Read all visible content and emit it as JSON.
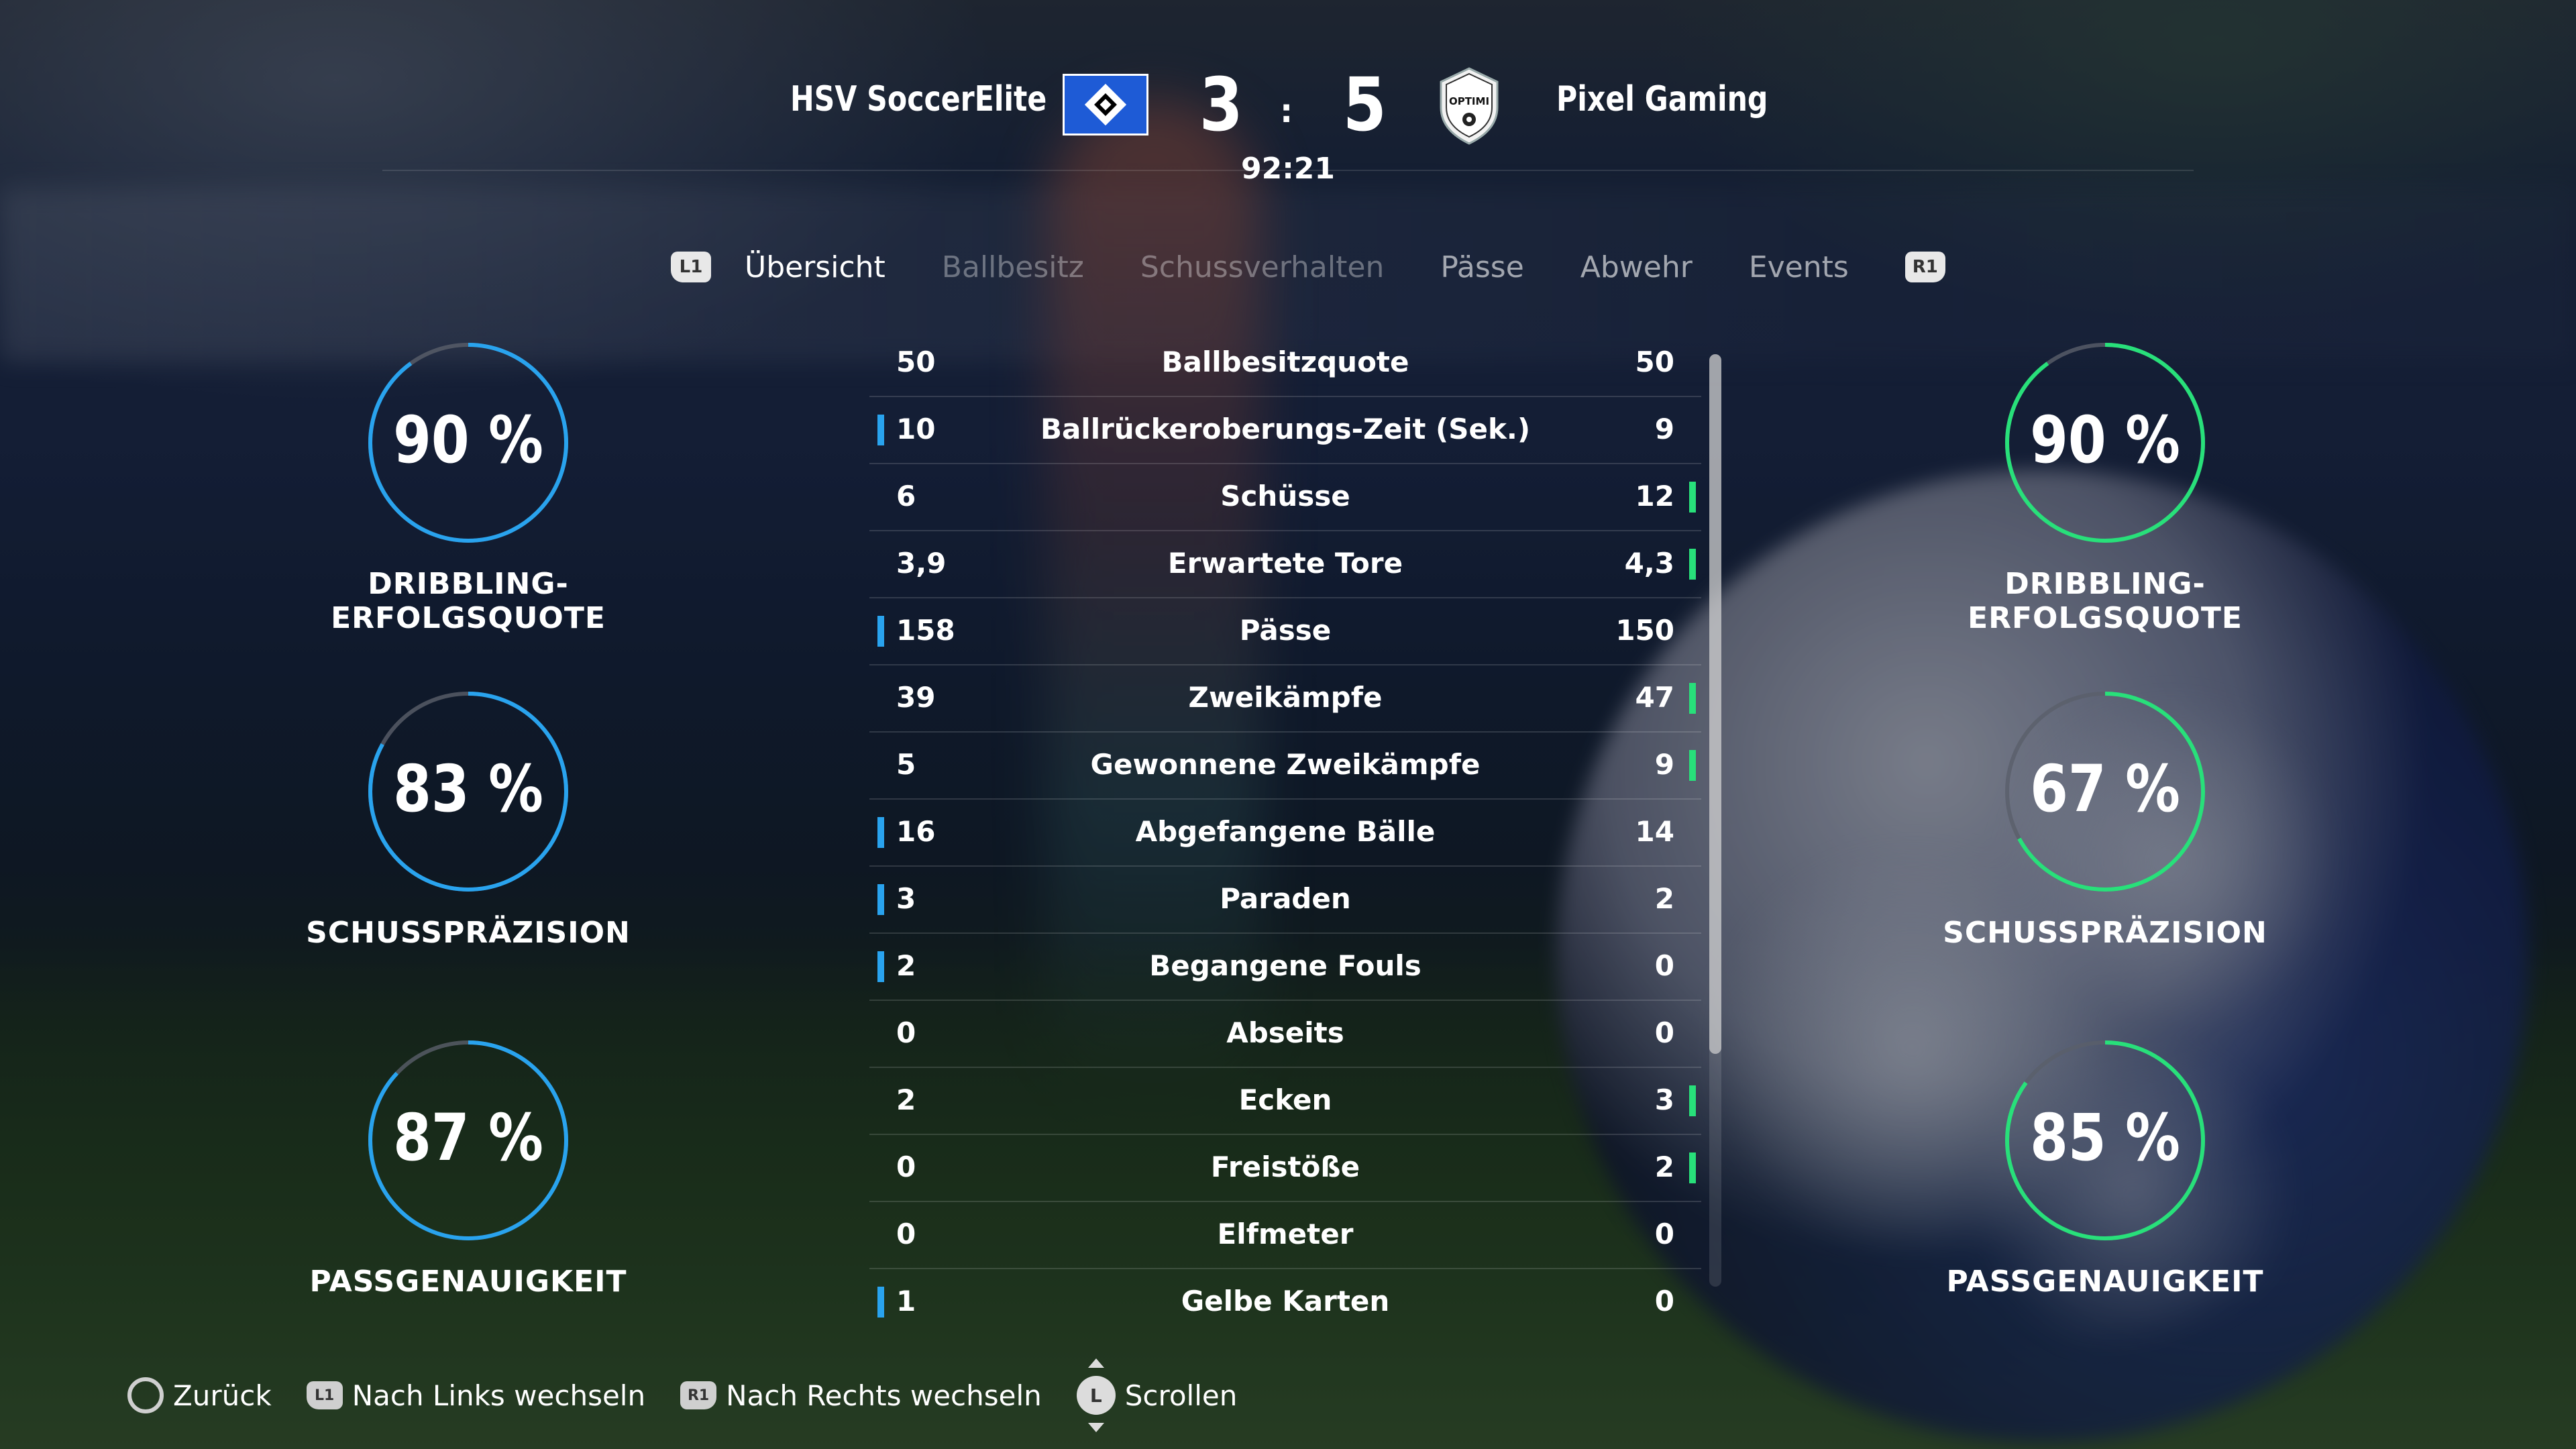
{
  "match": {
    "home_team": "HSV SoccerElite",
    "away_team": "Pixel Gaming",
    "home_score": "3",
    "away_score": "5",
    "score_separator": ":",
    "clock": "92:21",
    "away_crest_text": "OPTIMI"
  },
  "tabs": {
    "prev_button": "L1",
    "next_button": "R1",
    "items": [
      "Übersicht",
      "Ballbesitz",
      "Schussverhalten",
      "Pässe",
      "Abwehr",
      "Events"
    ],
    "active": "Übersicht"
  },
  "stats": [
    {
      "label": "Ballbesitzquote",
      "home": "50",
      "away": "50",
      "home_lead": false,
      "away_lead": false
    },
    {
      "label": "Ballrückeroberungs-Zeit (Sek.)",
      "home": "10",
      "away": "9",
      "home_lead": true,
      "away_lead": false
    },
    {
      "label": "Schüsse",
      "home": "6",
      "away": "12",
      "home_lead": false,
      "away_lead": true
    },
    {
      "label": "Erwartete Tore",
      "home": "3,9",
      "away": "4,3",
      "home_lead": false,
      "away_lead": true
    },
    {
      "label": "Pässe",
      "home": "158",
      "away": "150",
      "home_lead": true,
      "away_lead": false
    },
    {
      "label": "Zweikämpfe",
      "home": "39",
      "away": "47",
      "home_lead": false,
      "away_lead": true
    },
    {
      "label": "Gewonnene Zweikämpfe",
      "home": "5",
      "away": "9",
      "home_lead": false,
      "away_lead": true
    },
    {
      "label": "Abgefangene Bälle",
      "home": "16",
      "away": "14",
      "home_lead": true,
      "away_lead": false
    },
    {
      "label": "Paraden",
      "home": "3",
      "away": "2",
      "home_lead": true,
      "away_lead": false
    },
    {
      "label": "Begangene Fouls",
      "home": "2",
      "away": "0",
      "home_lead": true,
      "away_lead": false
    },
    {
      "label": "Abseits",
      "home": "0",
      "away": "0",
      "home_lead": false,
      "away_lead": false
    },
    {
      "label": "Ecken",
      "home": "2",
      "away": "3",
      "home_lead": false,
      "away_lead": true
    },
    {
      "label": "Freistöße",
      "home": "0",
      "away": "2",
      "home_lead": false,
      "away_lead": true
    },
    {
      "label": "Elfmeter",
      "home": "0",
      "away": "0",
      "home_lead": false,
      "away_lead": false
    },
    {
      "label": "Gelbe Karten",
      "home": "1",
      "away": "0",
      "home_lead": true,
      "away_lead": false
    }
  ],
  "gauges": {
    "home": [
      {
        "value_text": "90 %",
        "value": 90,
        "label": "DRIBBLING-ERFOLGSQUOTE"
      },
      {
        "value_text": "83 %",
        "value": 83,
        "label": "SCHUSSPRÄZISION"
      },
      {
        "value_text": "87 %",
        "value": 87,
        "label": "PASSGENAUIGKEIT"
      }
    ],
    "away": [
      {
        "value_text": "90 %",
        "value": 90,
        "label": "DRIBBLING-ERFOLGSQUOTE"
      },
      {
        "value_text": "67 %",
        "value": 67,
        "label": "SCHUSSPRÄZISION"
      },
      {
        "value_text": "85 %",
        "value": 85,
        "label": "PASSGENAUIGKEIT"
      }
    ]
  },
  "colors": {
    "home_accent": "#29a3ee",
    "away_accent": "#28e07a",
    "gauge_track": "#5a5f6a"
  },
  "footer": {
    "back": "Zurück",
    "left": "Nach Links wechseln",
    "left_button": "L1",
    "right": "Nach Rechts wechseln",
    "right_button": "R1",
    "scroll": "Scrollen",
    "scroll_button": "L"
  },
  "scrollbar": {
    "position": 0,
    "visible_fraction": 0.75
  }
}
